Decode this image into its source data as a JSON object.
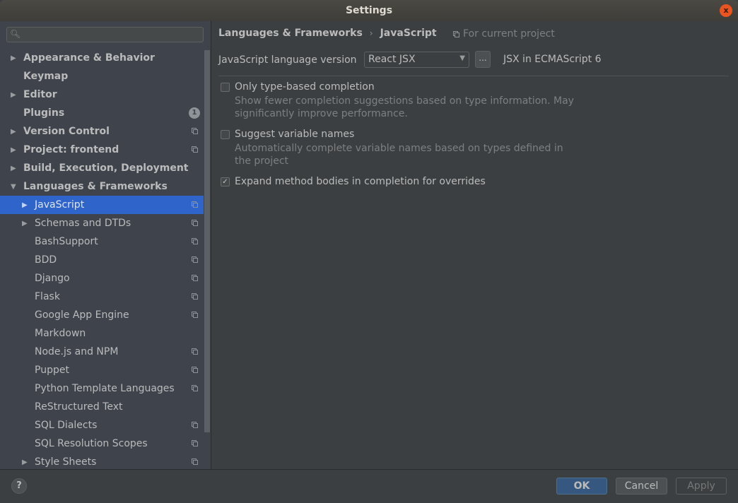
{
  "window": {
    "title": "Settings",
    "close_glyph": "x"
  },
  "search": {
    "value": "",
    "placeholder": ""
  },
  "sidebar": {
    "items": [
      {
        "label": "Appearance & Behavior",
        "level": 0,
        "arrow": "▶",
        "project": false
      },
      {
        "label": "Keymap",
        "level": 0,
        "arrow": "",
        "project": false
      },
      {
        "label": "Editor",
        "level": 0,
        "arrow": "▶",
        "project": false
      },
      {
        "label": "Plugins",
        "level": 0,
        "arrow": "",
        "project": false,
        "badge": "1"
      },
      {
        "label": "Version Control",
        "level": 0,
        "arrow": "▶",
        "project": true
      },
      {
        "label": "Project: frontend",
        "level": 0,
        "arrow": "▶",
        "project": true
      },
      {
        "label": "Build, Execution, Deployment",
        "level": 0,
        "arrow": "▶",
        "project": false
      },
      {
        "label": "Languages & Frameworks",
        "level": 0,
        "arrow": "▼",
        "project": false
      },
      {
        "label": "JavaScript",
        "level": 1,
        "arrow": "▶",
        "project": true,
        "selected": true
      },
      {
        "label": "Schemas and DTDs",
        "level": 1,
        "arrow": "▶",
        "project": true
      },
      {
        "label": "BashSupport",
        "level": 1,
        "arrow": "",
        "project": true
      },
      {
        "label": "BDD",
        "level": 1,
        "arrow": "",
        "project": true
      },
      {
        "label": "Django",
        "level": 1,
        "arrow": "",
        "project": true
      },
      {
        "label": "Flask",
        "level": 1,
        "arrow": "",
        "project": true
      },
      {
        "label": "Google App Engine",
        "level": 1,
        "arrow": "",
        "project": true
      },
      {
        "label": "Markdown",
        "level": 1,
        "arrow": "",
        "project": false
      },
      {
        "label": "Node.js and NPM",
        "level": 1,
        "arrow": "",
        "project": true
      },
      {
        "label": "Puppet",
        "level": 1,
        "arrow": "",
        "project": true
      },
      {
        "label": "Python Template Languages",
        "level": 1,
        "arrow": "",
        "project": true
      },
      {
        "label": "ReStructured Text",
        "level": 1,
        "arrow": "",
        "project": false
      },
      {
        "label": "SQL Dialects",
        "level": 1,
        "arrow": "",
        "project": true
      },
      {
        "label": "SQL Resolution Scopes",
        "level": 1,
        "arrow": "",
        "project": true
      },
      {
        "label": "Style Sheets",
        "level": 1,
        "arrow": "▶",
        "project": true
      }
    ]
  },
  "main": {
    "breadcrumb": [
      "Languages & Frameworks",
      "JavaScript"
    ],
    "breadcrumb_sep": "›",
    "scope_label": "For current project",
    "language_version": {
      "label": "JavaScript language version",
      "selected": "React JSX",
      "more_button": "...",
      "description": "JSX in ECMAScript 6"
    },
    "options": [
      {
        "label": "Only type-based completion",
        "checked": false,
        "description": "Show fewer completion suggestions based on type information. May significantly improve performance."
      },
      {
        "label": "Suggest variable names",
        "checked": false,
        "description": "Automatically complete variable names based on types defined in the project"
      },
      {
        "label": "Expand method bodies in completion for overrides",
        "checked": true,
        "description": ""
      }
    ]
  },
  "footer": {
    "help": "?",
    "ok": "OK",
    "cancel": "Cancel",
    "apply": "Apply"
  },
  "colors": {
    "selection": "#2f65ca",
    "ok_button": "#365880",
    "close_button": "#e95420"
  }
}
